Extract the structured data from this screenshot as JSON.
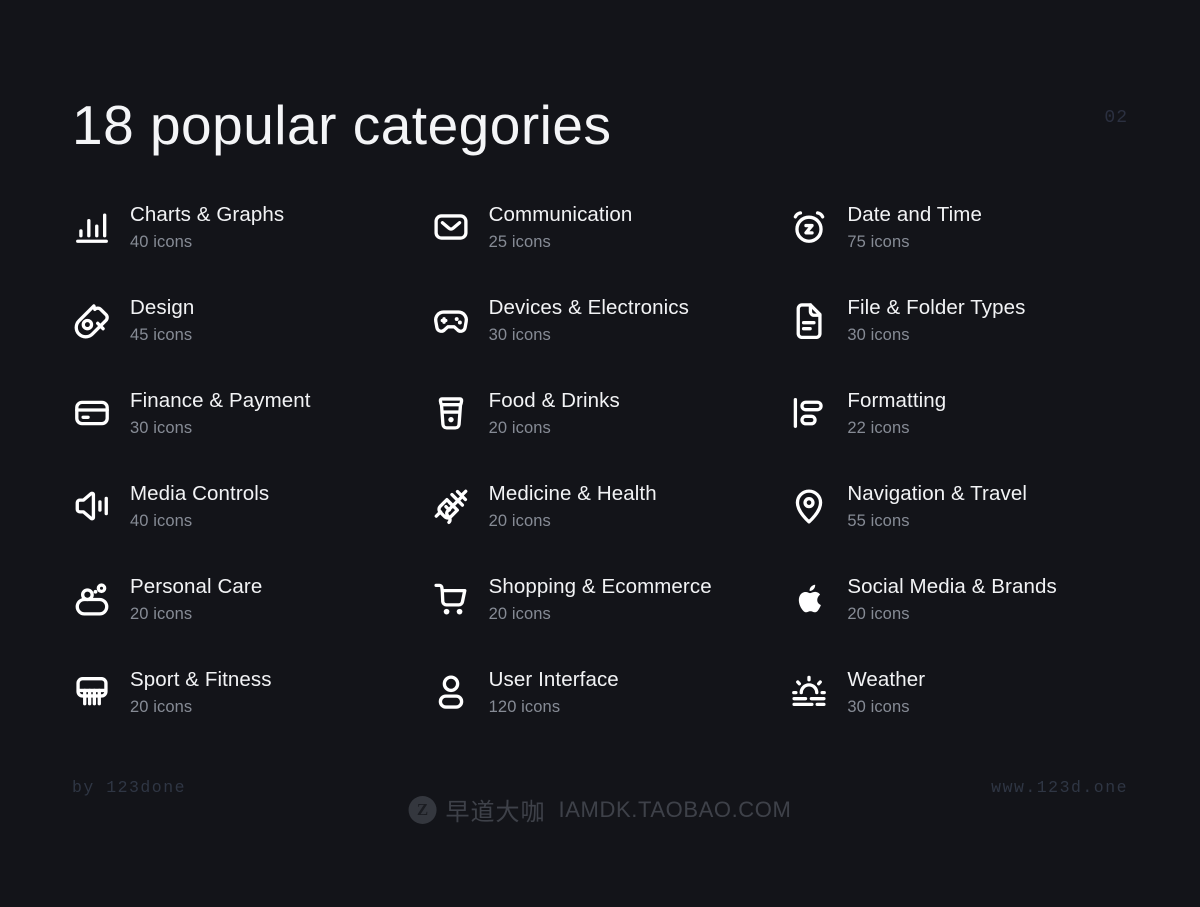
{
  "header": {
    "title": "18 popular categories",
    "page_number": "02"
  },
  "colors": {
    "background": "#131419",
    "title_text": "#f4f5f7",
    "category_name": "#f2f3f5",
    "category_count": "#868b95",
    "muted_accent": "#2f3644",
    "icon_stroke": "#ffffff"
  },
  "categories": [
    {
      "name": "Charts & Graphs",
      "count": "40 icons",
      "icon": "bar-chart-icon"
    },
    {
      "name": "Communication",
      "count": "25 icons",
      "icon": "envelope-icon"
    },
    {
      "name": "Date and Time",
      "count": "75 icons",
      "icon": "alarm-clock-snooze-icon"
    },
    {
      "name": "Design",
      "count": "45 icons",
      "icon": "pen-nib-icon"
    },
    {
      "name": "Devices & Electronics",
      "count": "30 icons",
      "icon": "gamepad-icon"
    },
    {
      "name": "File & Folder Types",
      "count": "30 icons",
      "icon": "document-file-icon"
    },
    {
      "name": "Finance & Payment",
      "count": "30 icons",
      "icon": "credit-card-icon"
    },
    {
      "name": "Food & Drinks",
      "count": "20 icons",
      "icon": "coffee-cup-icon"
    },
    {
      "name": "Formatting",
      "count": "22 icons",
      "icon": "align-left-icon"
    },
    {
      "name": "Media Controls",
      "count": "40 icons",
      "icon": "volume-speaker-icon"
    },
    {
      "name": "Medicine & Health",
      "count": "20 icons",
      "icon": "syringe-icon"
    },
    {
      "name": "Navigation & Travel",
      "count": "55 icons",
      "icon": "map-pin-icon"
    },
    {
      "name": "Personal Care",
      "count": "20 icons",
      "icon": "soap-bar-icon"
    },
    {
      "name": "Shopping & Ecommerce",
      "count": "20 icons",
      "icon": "shopping-cart-icon"
    },
    {
      "name": "Social Media & Brands",
      "count": "20 icons",
      "icon": "apple-logo-icon"
    },
    {
      "name": "Sport & Fitness",
      "count": "20 icons",
      "icon": "basketball-hoop-icon"
    },
    {
      "name": "User Interface",
      "count": "120 icons",
      "icon": "user-person-icon"
    },
    {
      "name": "Weather",
      "count": "30 icons",
      "icon": "sunrise-icon"
    }
  ],
  "footer": {
    "left": "by  123done",
    "right": "www.123d.one"
  },
  "watermark": {
    "logo_letter": "Z",
    "chinese_text": "早道大咖",
    "url_text": "IAMDK.TAOBAO.COM"
  }
}
